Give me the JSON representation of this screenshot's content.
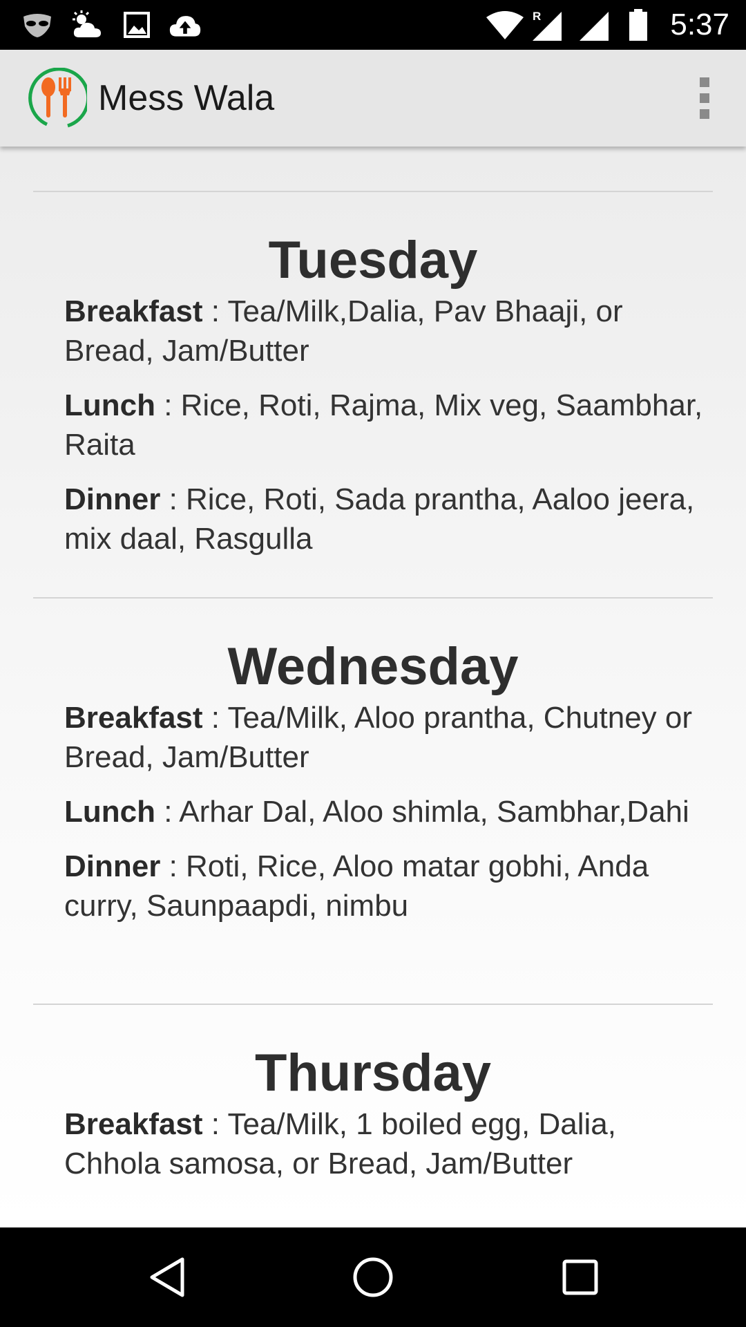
{
  "status_bar": {
    "time": "5:37",
    "icons": [
      "incognito-mask-icon",
      "weather-cloud-sun-icon",
      "image-icon",
      "cloud-upload-icon",
      "wifi-icon",
      "signal-roaming-icon",
      "signal-icon",
      "battery-icon"
    ]
  },
  "app_bar": {
    "title": "Mess Wala",
    "logo_icon": "spoon-fork-logo-icon",
    "menu_icon": "overflow-menu-icon",
    "accent_color": "#f26a21",
    "ring_color": "#1aa64a"
  },
  "menu": {
    "days": [
      {
        "name": "Tuesday",
        "meals": [
          {
            "label": "Breakfast",
            "text": " : Tea/Milk,Dalia, Pav Bhaaji, or Bread, Jam/Butter"
          },
          {
            "label": "Lunch",
            "text": " : Rice, Roti, Rajma, Mix veg, Saambhar, Raita"
          },
          {
            "label": "Dinner",
            "text": " : Rice, Roti, Sada prantha, Aaloo jeera, mix daal, Rasgulla"
          }
        ]
      },
      {
        "name": "Wednesday",
        "meals": [
          {
            "label": "Breakfast",
            "text": " : Tea/Milk, Aloo prantha, Chutney or Bread, Jam/Butter"
          },
          {
            "label": "Lunch",
            "text": " : Arhar Dal, Aloo shimla, Sambhar,Dahi"
          },
          {
            "label": "Dinner",
            "text": " : Roti, Rice, Aloo matar gobhi, Anda curry, Saunpaapdi, nimbu"
          }
        ]
      },
      {
        "name": "Thursday",
        "meals": [
          {
            "label": "Breakfast",
            "text": " : Tea/Milk, 1 boiled egg, Dalia, Chhola samosa, or Bread, Jam/Butter"
          }
        ]
      }
    ]
  },
  "nav_bar": {
    "buttons": [
      "back-icon",
      "home-icon",
      "recents-icon"
    ]
  }
}
